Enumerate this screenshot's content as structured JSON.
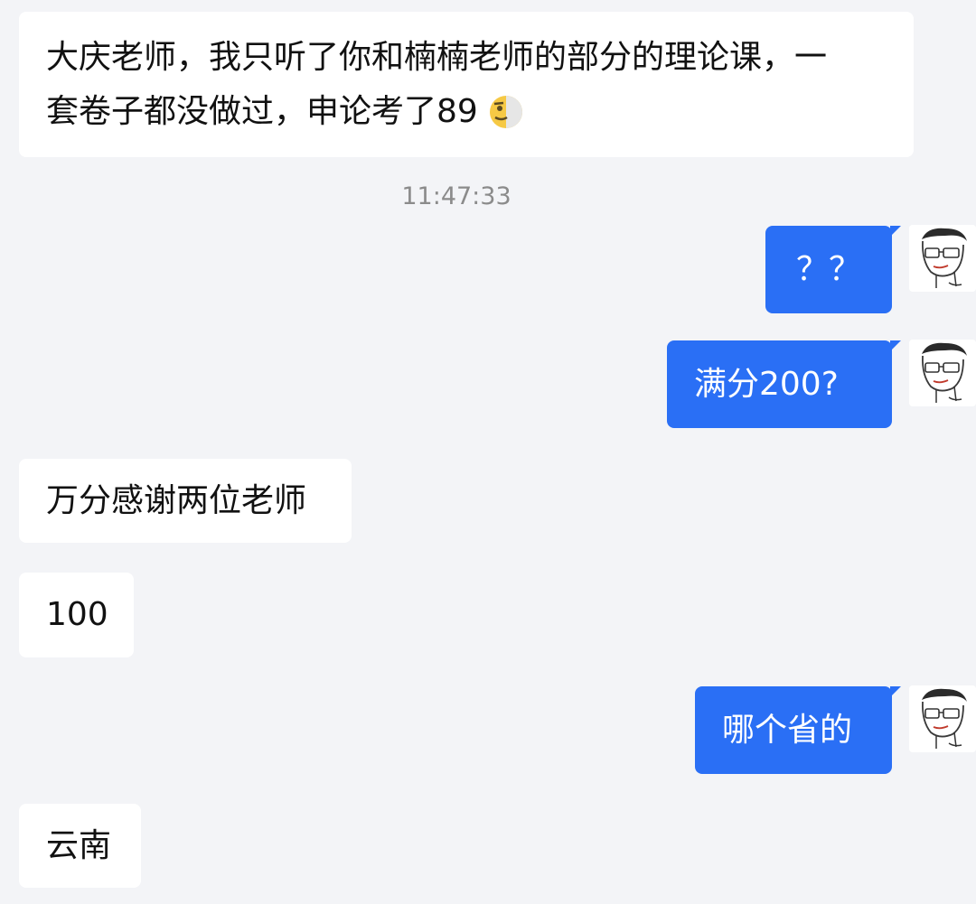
{
  "messages": [
    {
      "id": "m1",
      "direction": "incoming",
      "line1": "大庆老师，我只听了你和楠楠老师的部分的理论课，一",
      "line2": "套卷子都没做过，申论考了89",
      "emoji": "smirk-face-emoji"
    },
    {
      "id": "timestamp",
      "text": "11:47:33"
    },
    {
      "id": "m2",
      "direction": "outgoing",
      "text": "？？",
      "avatar": "teacher-avatar"
    },
    {
      "id": "m3",
      "direction": "outgoing",
      "text": "满分200?",
      "avatar": "teacher-avatar"
    },
    {
      "id": "m4",
      "direction": "incoming",
      "text": "万分感谢两位老师"
    },
    {
      "id": "m5",
      "direction": "incoming",
      "text": "100"
    },
    {
      "id": "m6",
      "direction": "outgoing",
      "text": "哪个省的",
      "avatar": "teacher-avatar"
    },
    {
      "id": "m7",
      "direction": "incoming",
      "text": "云南"
    }
  ],
  "colors": {
    "background": "#f3f4f7",
    "incoming_bubble": "#ffffff",
    "outgoing_bubble": "#2a6ff5",
    "timestamp_text": "#8b8b8b"
  }
}
